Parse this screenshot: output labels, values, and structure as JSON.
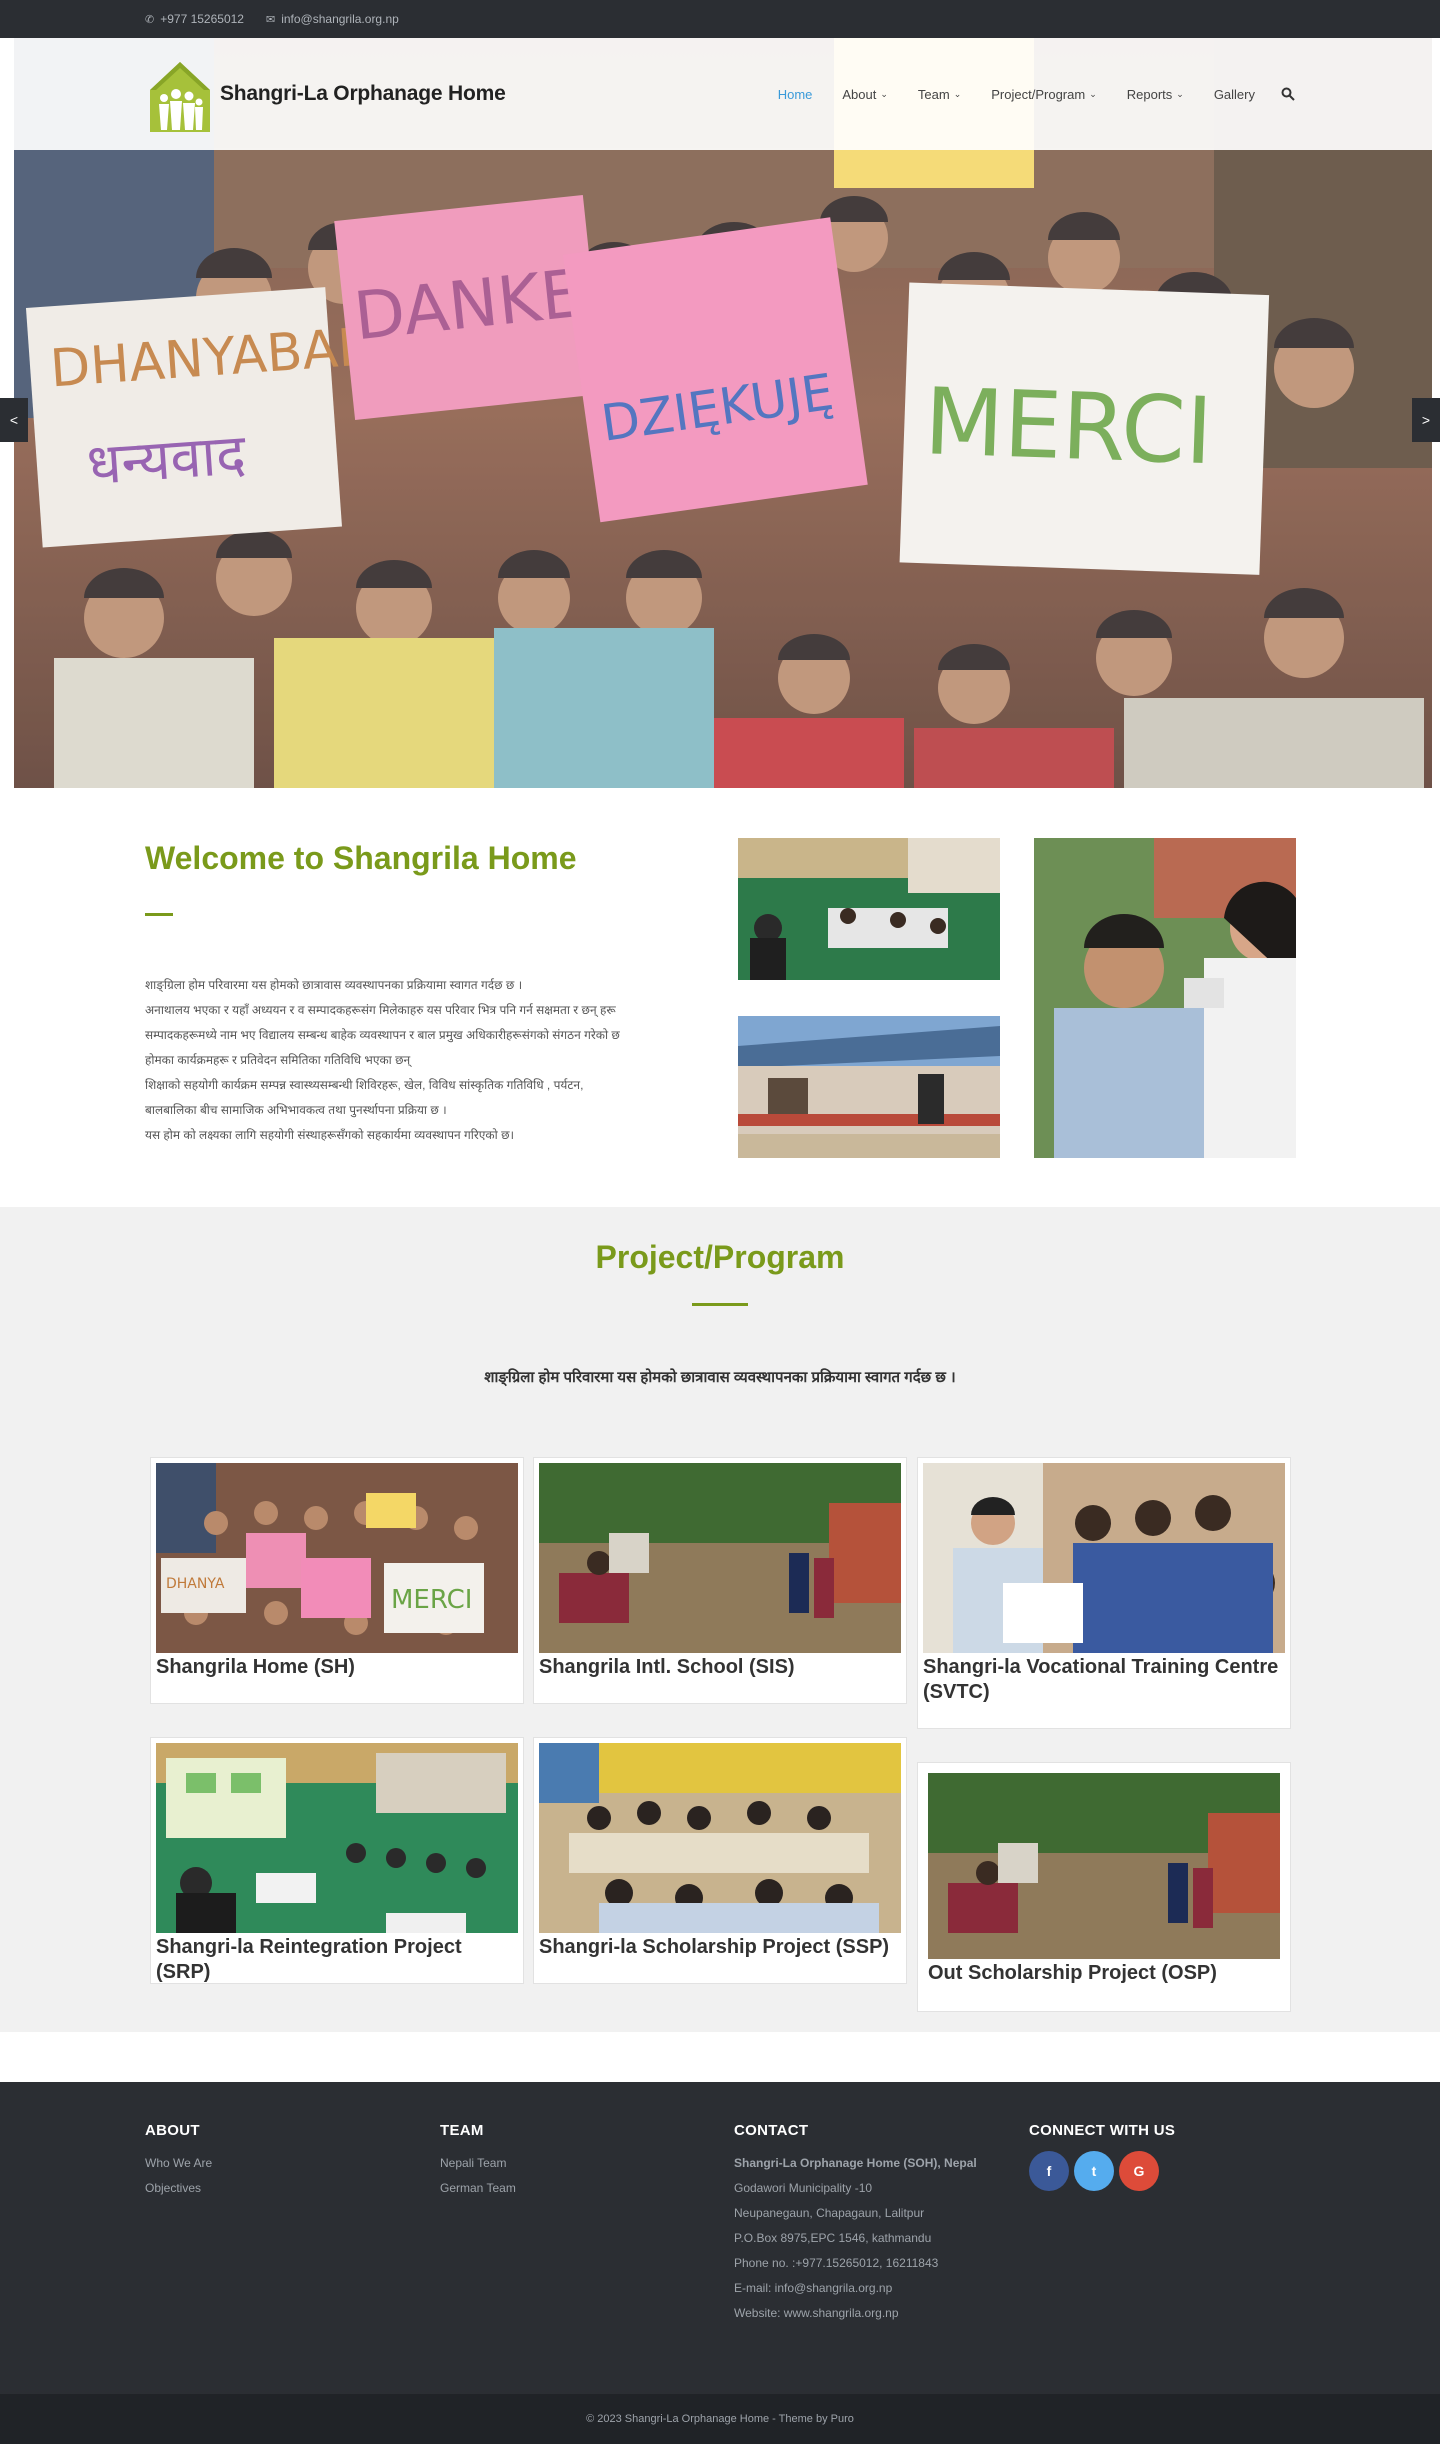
{
  "topbar": {
    "phone": "+977 15265012",
    "email": "info@shangrila.org.np"
  },
  "header": {
    "logo_text": "Shangri-La Orphanage Home",
    "nav": [
      {
        "label": "Home",
        "active": true,
        "dropdown": false
      },
      {
        "label": "About",
        "active": false,
        "dropdown": true
      },
      {
        "label": "Team",
        "active": false,
        "dropdown": true
      },
      {
        "label": "Project/Program",
        "active": false,
        "dropdown": true
      },
      {
        "label": "Reports",
        "active": false,
        "dropdown": true
      },
      {
        "label": "Gallery",
        "active": false,
        "dropdown": false
      }
    ],
    "search_icon": "search-icon"
  },
  "hero": {
    "signs": [
      "DHANYABAD",
      "धन्यवाद",
      "DANKE",
      "DZIĘKUJĘ",
      "MERCI"
    ],
    "prev_arrow": "<",
    "next_arrow": ">"
  },
  "welcome": {
    "title": "Welcome to Shangrila Home",
    "paragraphs": [
      "शाङ्ग्रिला होम परिवारमा यस होमको छात्रावास व्यवस्थापनका प्रक्रियामा स्वागत गर्दछ छ ।",
      "अनाथालय भएका र यहाँ अध्ययन र व सम्पादकहरूसंग मिलेकाहरु यस परिवार भित्र पनि गर्न सक्षमता र छन् हरू",
      "सम्पादकहरूमध्ये नाम भए विद्यालय सम्बन्ध बाहेक व्यवस्थापन र बाल प्रमुख अधिकारीहरूसंगको संगठन गरेको छ",
      "होमका कार्यक्रमहरू र प्रतिवेदन समितिका गतिविधि भएका छन्",
      "शिक्षाको सहयोगी कार्यक्रम सम्पन्न स्वास्थ्यसम्बन्धी शिविरहरू, खेल, विविध सांस्कृतिक गतिविधि , पर्यटन,",
      "बालबालिका बीच सामाजिक अभिभावकत्व तथा पुनर्स्थापना प्रक्रिया छ ।",
      "यस होम को लक्ष्यका लागि सहयोगी संस्थाहरूसँगको सहकार्यमा व्यवस्थापन गरिएको छ।"
    ]
  },
  "projects": {
    "title": "Project/Program",
    "subtitle": "शाङ्ग्रिला होम परिवारमा यस होमको छात्रावास व्यवस्थापनका प्रक्रियामा स्वागत गर्दछ छ ।",
    "cards": [
      {
        "title": "Shangrila Home (SH)"
      },
      {
        "title": "Shangrila Intl. School (SIS)"
      },
      {
        "title": "Shangri-la Vocational Training Centre (SVTC)"
      },
      {
        "title": "Shangri-la Reintegration Project (SRP)"
      },
      {
        "title": "Shangri-la Scholarship Project (SSP)"
      },
      {
        "title": "Out Scholarship Project (OSP)"
      }
    ]
  },
  "footer": {
    "about": {
      "heading": "ABOUT",
      "links": [
        "Who We Are",
        "Objectives"
      ]
    },
    "team": {
      "heading": "TEAM",
      "links": [
        "Nepali Team",
        "German Team"
      ]
    },
    "contact": {
      "heading": "CONTACT",
      "org": "Shangri-La Orphanage Home (SOH), Nepal",
      "lines": [
        "Godawori  Municipality -10",
        "Neupanegaun, Chapagaun, Lalitpur",
        "P.O.Box 8975,EPC 1546, kathmandu",
        "Phone no. :+977.15265012, 16211843",
        "E-mail: info@shangrila.org.np",
        "Website: www.shangrila.org.np"
      ]
    },
    "connect": {
      "heading": "CONNECT WITH US",
      "social": [
        {
          "name": "facebook",
          "glyph": "f",
          "color": "#3b5998"
        },
        {
          "name": "twitter",
          "glyph": "t",
          "color": "#55acee"
        },
        {
          "name": "google-plus",
          "glyph": "G",
          "color": "#dd4b39"
        }
      ]
    },
    "copyright": "© 2023 Shangri-La Orphanage Home  -  Theme by Puro"
  }
}
